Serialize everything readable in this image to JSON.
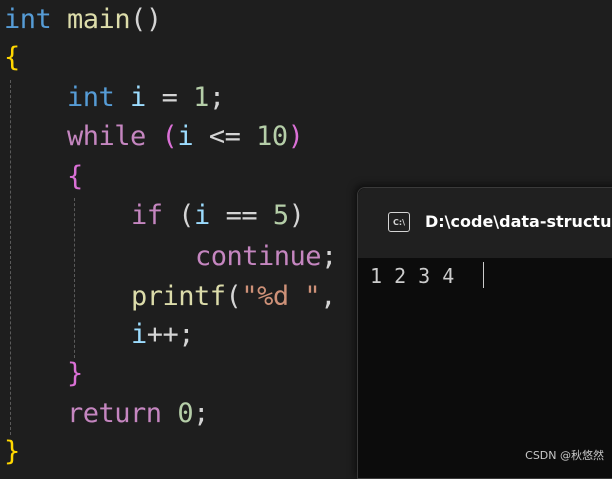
{
  "code": {
    "line1": {
      "kw": "int",
      "fn": "main",
      "punct": "()"
    },
    "line2": {
      "brace": "{"
    },
    "line3": {
      "kw": "int",
      "var": "i",
      "op": "=",
      "num": "1",
      "end": ";"
    },
    "line4": {
      "kw": "while",
      "open": "(",
      "var": "i",
      "op": "<=",
      "num": "10",
      "close": ")"
    },
    "line5": {
      "brace": "{"
    },
    "line6": {
      "kw": "if",
      "open": "(",
      "var": "i",
      "op": "==",
      "num": "5",
      "close": ")"
    },
    "line7": {
      "kw": "continue",
      "end": ";"
    },
    "line8": {
      "fn": "printf",
      "open": "(",
      "str": "\"%d \"",
      "end": ","
    },
    "line9": {
      "var": "i",
      "op": "++",
      "end": ";"
    },
    "line10": {
      "brace": "}"
    },
    "line11": {
      "kw": "return",
      "num": "0",
      "end": ";"
    },
    "line12": {
      "brace": "}"
    }
  },
  "terminal": {
    "icon_label": "C:\\",
    "title": "D:\\code\\data-structure",
    "output": "1 2 3 4"
  },
  "watermark": "CSDN @秋悠然"
}
